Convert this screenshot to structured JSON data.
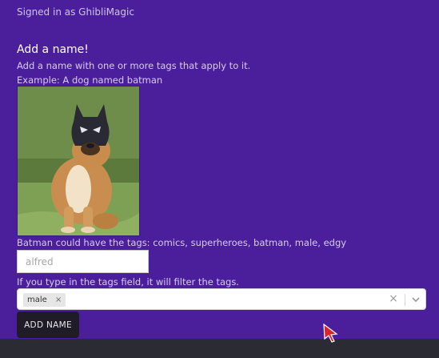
{
  "header": {
    "signed_in": "Signed in as GhibliMagic"
  },
  "form": {
    "title": "Add a name!",
    "subtitle": "Add a name with one or more tags that apply to it.",
    "example": "Example: A dog named batman",
    "tags_hint": "Batman could have the tags: comics, superheroes, batman, male, edgy",
    "name_placeholder": "alfred",
    "filter_hint": "If you type in the tags field, it will filter the tags.",
    "selected_tags": [
      "male"
    ],
    "submit_label": "ADD NAME"
  },
  "icons": {
    "chip_remove": "×",
    "clear": "×",
    "dropdown": "chevron-down-icon"
  },
  "colors": {
    "background": "#4b1f9c",
    "button": "#1f1c27",
    "footer": "#2b2c33"
  }
}
